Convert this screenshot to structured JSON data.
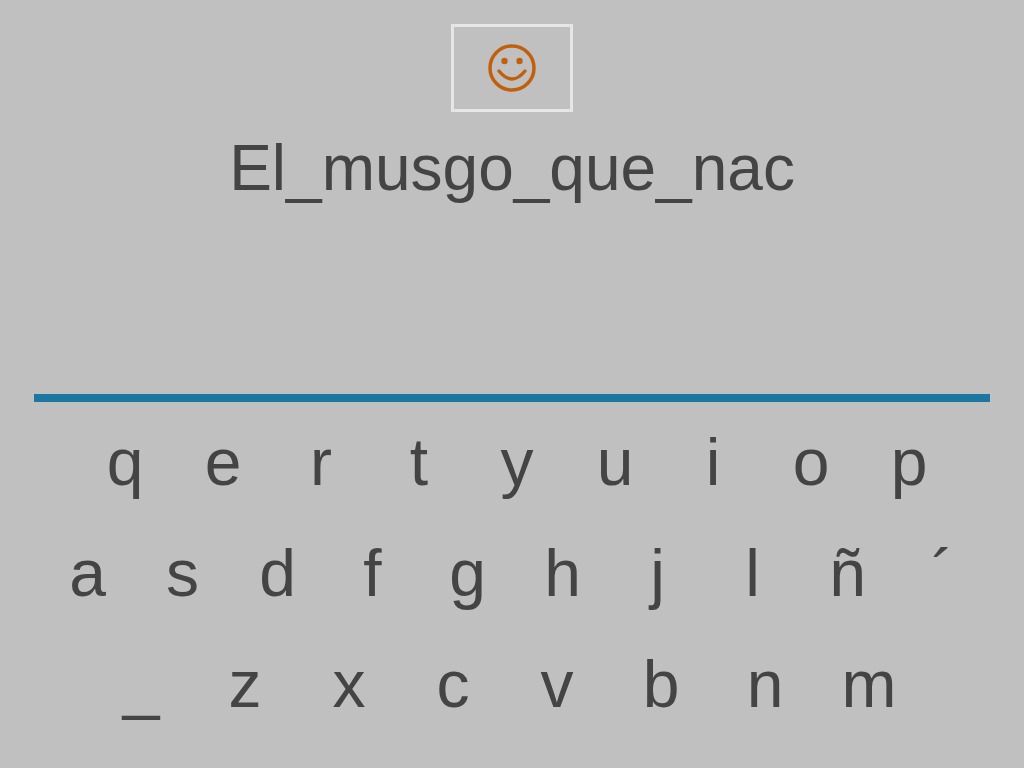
{
  "feedback_icon": {
    "kind": "smiley"
  },
  "phrase": "El_musgo_que_nac",
  "keyboard": {
    "rows": [
      [
        "q",
        "e",
        "r",
        "t",
        "y",
        "u",
        "i",
        "o",
        "p"
      ],
      [
        "a",
        "s",
        "d",
        "f",
        "g",
        "h",
        "j",
        "l",
        "ñ",
        "´"
      ],
      [
        "_",
        "z",
        "x",
        "c",
        "v",
        "b",
        "n",
        "m"
      ]
    ]
  }
}
